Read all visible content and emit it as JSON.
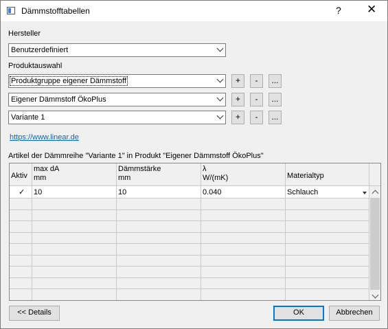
{
  "window": {
    "title": "Dämmstofftabellen",
    "help": "?",
    "close": "✕"
  },
  "hersteller": {
    "label": "Hersteller",
    "value": "Benutzerdefiniert"
  },
  "produktauswahl": {
    "label": "Produktauswahl",
    "rows": [
      {
        "value": "Produktgruppe eigener Dämmstoff",
        "add": "+",
        "remove": "-",
        "more": "..."
      },
      {
        "value": "Eigener Dämmstoff ÖkoPlus",
        "add": "+",
        "remove": "-",
        "more": "..."
      },
      {
        "value": "Variante 1",
        "add": "+",
        "remove": "-",
        "more": "..."
      }
    ]
  },
  "link": {
    "text": "https://www.linear.de"
  },
  "table": {
    "caption": "Artikel der Dämmreihe \"Variante 1\" in Produkt \"Eigener Dämmstoff ÖkoPlus\"",
    "columns": [
      {
        "line1": "Aktiv",
        "line2": ""
      },
      {
        "line1": "max dA",
        "line2": "mm"
      },
      {
        "line1": "Dämmstärke",
        "line2": "mm"
      },
      {
        "line1": "λ",
        "line2": "W/(mK)"
      },
      {
        "line1": "Materialtyp",
        "line2": ""
      }
    ],
    "rows": [
      {
        "aktiv": "✓",
        "max_da": "10",
        "daemmstaerke": "10",
        "lambda": "0.040",
        "materialtyp": "Schlauch"
      }
    ]
  },
  "buttons": {
    "details": "<< Details",
    "ok": "OK",
    "cancel": "Abbrechen"
  }
}
